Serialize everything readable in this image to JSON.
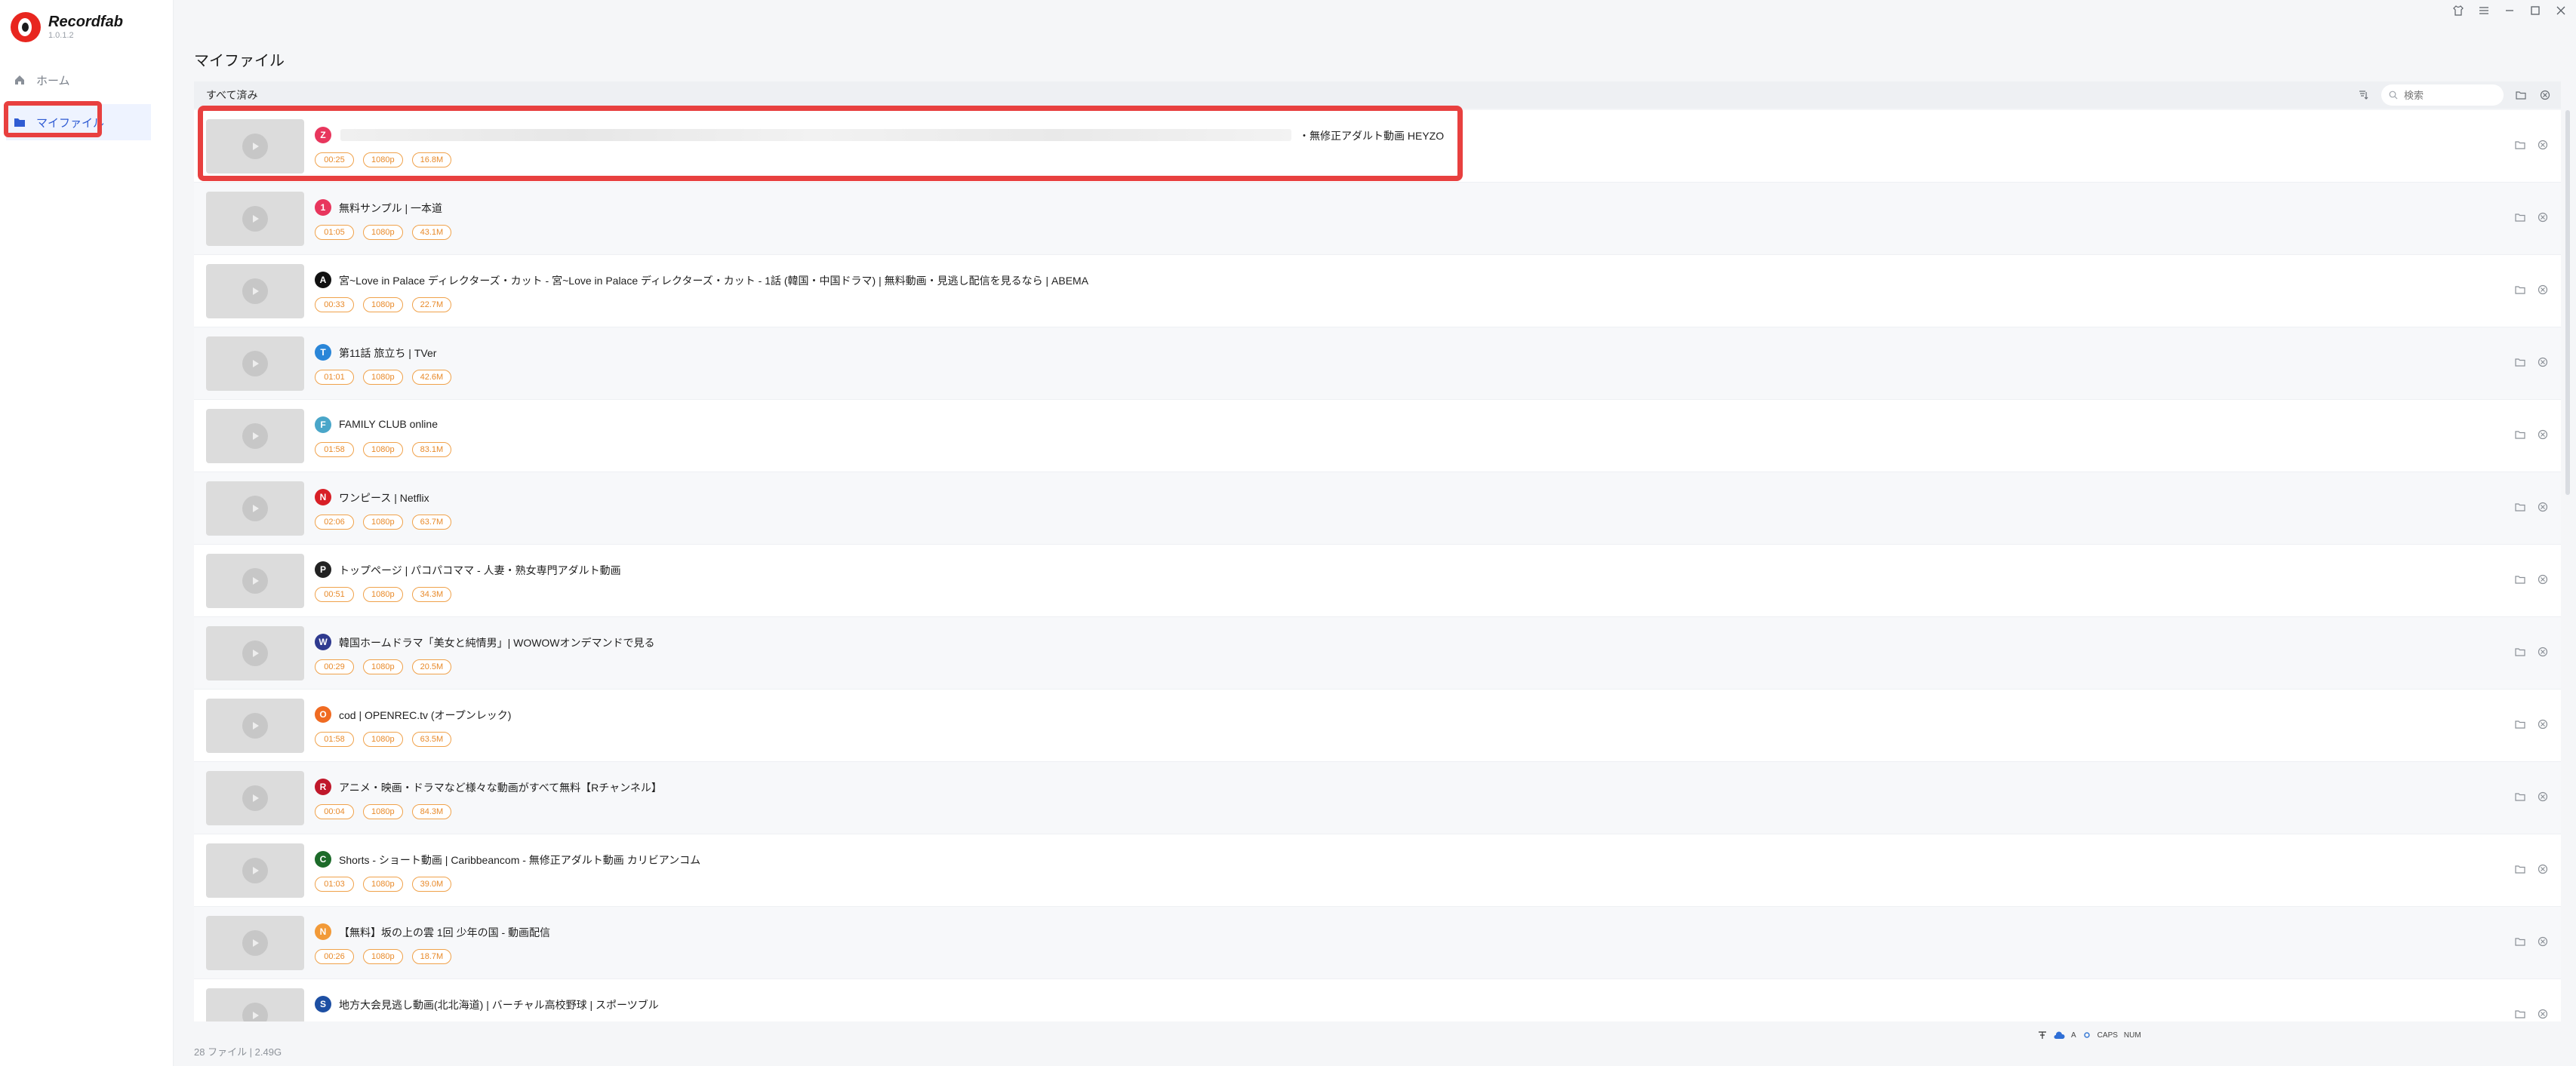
{
  "app": {
    "name": "Recordfab",
    "version": "1.0.1.2",
    "accent": "#e8261f",
    "highlight_color": "#e8403f"
  },
  "sidebar": {
    "items": [
      {
        "label": "ホーム",
        "icon": "home-icon",
        "active": false
      },
      {
        "label": "マイファイル",
        "icon": "folder-icon",
        "active": true
      }
    ]
  },
  "window_controls": [
    "shirt-icon",
    "menu-icon",
    "minimize-icon",
    "maximize-icon",
    "close-icon"
  ],
  "main": {
    "title": "マイファイル",
    "list_header": "すべて済み",
    "search_placeholder": "検索"
  },
  "files": [
    {
      "title": "・無修正アダルト動画 HEYZO",
      "icon_label": "Z",
      "icon_color": "#e8365d",
      "duration": "00:25",
      "resolution": "1080p",
      "size": "16.8M",
      "blurred": true
    },
    {
      "title": "無料サンプル | 一本道",
      "icon_label": "1",
      "icon_color": "#e8365d",
      "duration": "01:05",
      "resolution": "1080p",
      "size": "43.1M"
    },
    {
      "title": "宮~Love in Palace ディレクターズ・カット - 宮~Love in Palace ディレクターズ・カット - 1話 (韓国・中国ドラマ) | 無料動画・見逃し配信を見るなら | ABEMA",
      "icon_label": "A",
      "icon_color": "#111111",
      "duration": "00:33",
      "resolution": "1080p",
      "size": "22.7M"
    },
    {
      "title": "第11話 旅立ち | TVer",
      "icon_label": "T",
      "icon_color": "#2a86d8",
      "duration": "01:01",
      "resolution": "1080p",
      "size": "42.6M"
    },
    {
      "title": "FAMILY CLUB online",
      "icon_label": "F",
      "icon_color": "#4aa6c9",
      "duration": "01:58",
      "resolution": "1080p",
      "size": "83.1M"
    },
    {
      "title": "ワンピース | Netflix",
      "icon_label": "N",
      "icon_color": "#d81f26",
      "duration": "02:06",
      "resolution": "1080p",
      "size": "63.7M"
    },
    {
      "title": "トップページ | パコパコママ - 人妻・熟女専門アダルト動画",
      "icon_label": "P",
      "icon_color": "#222222",
      "duration": "00:51",
      "resolution": "1080p",
      "size": "34.3M"
    },
    {
      "title": "韓国ホームドラマ「美女と純情男」| WOWOWオンデマンドで見る",
      "icon_label": "W",
      "icon_color": "#2f3a8f",
      "duration": "00:29",
      "resolution": "1080p",
      "size": "20.5M"
    },
    {
      "title": "cod | OPENREC.tv (オープンレック)",
      "icon_label": "O",
      "icon_color": "#f06b22",
      "duration": "01:58",
      "resolution": "1080p",
      "size": "63.5M"
    },
    {
      "title": "アニメ・映画・ドラマなど様々な動画がすべて無料【Rチャンネル】",
      "icon_label": "R",
      "icon_color": "#c0182b",
      "duration": "00:04",
      "resolution": "1080p",
      "size": "84.3M"
    },
    {
      "title": "Shorts - ショート動画 | Caribbeancom - 無修正アダルト動画 カリビアンコム",
      "icon_label": "C",
      "icon_color": "#1d6b2a",
      "duration": "01:03",
      "resolution": "1080p",
      "size": "39.0M"
    },
    {
      "title": "【無料】坂の上の雲 1回 少年の国 - 動画配信",
      "icon_label": "N",
      "icon_color": "#f29a38",
      "duration": "00:26",
      "resolution": "1080p",
      "size": "18.7M"
    },
    {
      "title": "地方大会見逃し動画(北北海道) | バーチャル高校野球 | スポーツブル",
      "icon_label": "S",
      "icon_color": "#1d4fa3",
      "duration": "",
      "resolution": "",
      "size": ""
    }
  ],
  "status": {
    "summary": "28 ファイル  |  2.49G"
  },
  "tray": {
    "ime": "A",
    "caps": "CAPS",
    "num": "NUM"
  }
}
